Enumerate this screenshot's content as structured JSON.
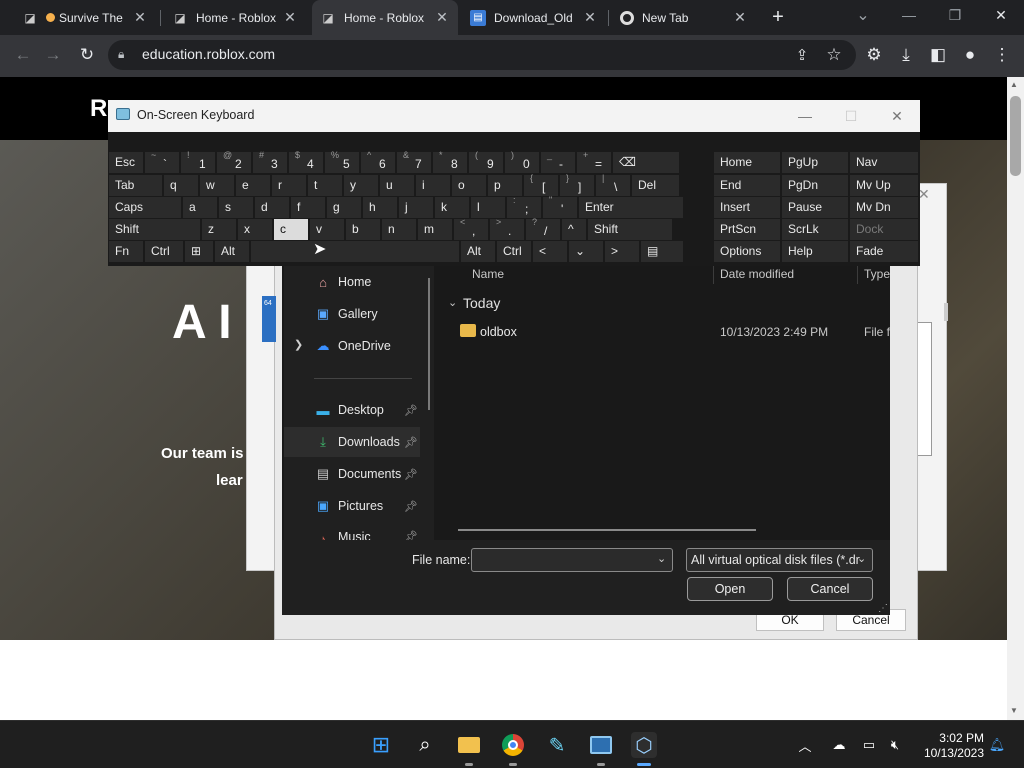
{
  "browser": {
    "tabs": [
      {
        "title": "Survive The",
        "icon": "roblox-icon"
      },
      {
        "title": "Home - Roblox",
        "icon": "roblox-icon"
      },
      {
        "title": "Home - Roblox",
        "icon": "roblox-icon"
      },
      {
        "title": "Download_Old",
        "icon": "document-icon"
      },
      {
        "title": "New Tab",
        "icon": "chrome-icon"
      }
    ],
    "new_tab": "+",
    "window_controls": {
      "minimize": "—",
      "restore": "❐",
      "close": "✕",
      "tab_search": "⌄"
    },
    "url": "education.roblox.com"
  },
  "page": {
    "logo": "R",
    "hero_title": "A I",
    "hero_line1": "Our team is",
    "hero_line2": "lear",
    "bg_dialog": {
      "close": "✕",
      "ok": "OK",
      "cancel": "Cancel",
      "badge": "64"
    }
  },
  "file_dialog": {
    "nav": [
      {
        "label": "Home",
        "icon": "home-icon"
      },
      {
        "label": "Gallery",
        "icon": "gallery-icon"
      },
      {
        "label": "OneDrive",
        "icon": "cloud-icon"
      },
      {
        "label": "Desktop",
        "icon": "desktop-icon"
      },
      {
        "label": "Downloads",
        "icon": "download-icon"
      },
      {
        "label": "Documents",
        "icon": "documents-icon"
      },
      {
        "label": "Pictures",
        "icon": "pictures-icon"
      },
      {
        "label": "Music",
        "icon": "music-icon"
      }
    ],
    "columns": {
      "name": "Name",
      "date": "Date modified",
      "type": "Type"
    },
    "group": "Today",
    "files": [
      {
        "name": "oldbox",
        "date": "10/13/2023 2:49 PM",
        "type": "File fo"
      }
    ],
    "file_name_label": "File name:",
    "file_name_value": "",
    "filter": "All virtual optical disk files (*.dr",
    "open": "Open",
    "cancel": "Cancel"
  },
  "osk": {
    "title": "On-Screen Keyboard",
    "rows": [
      [
        {
          "label": "Esc",
          "w": 36
        },
        {
          "shift": "~",
          "label": "`",
          "w": 36
        },
        {
          "shift": "!",
          "label": "1",
          "w": 36
        },
        {
          "shift": "@",
          "label": "2",
          "w": 36
        },
        {
          "shift": "#",
          "label": "3",
          "w": 36
        },
        {
          "shift": "$",
          "label": "4",
          "w": 36
        },
        {
          "shift": "%",
          "label": "5",
          "w": 36
        },
        {
          "shift": "^",
          "label": "6",
          "w": 36
        },
        {
          "shift": "&",
          "label": "7",
          "w": 36
        },
        {
          "shift": "*",
          "label": "8",
          "w": 36
        },
        {
          "shift": "(",
          "label": "9",
          "w": 36
        },
        {
          "shift": ")",
          "label": "0",
          "w": 36
        },
        {
          "shift": "_",
          "label": "-",
          "w": 36
        },
        {
          "shift": "+",
          "label": "=",
          "w": 36
        },
        {
          "label": "⌫",
          "w": 68
        }
      ],
      [
        {
          "label": "Tab",
          "w": 55
        },
        {
          "label": "q",
          "w": 36
        },
        {
          "label": "w",
          "w": 36
        },
        {
          "label": "e",
          "w": 36
        },
        {
          "label": "r",
          "w": 36
        },
        {
          "label": "t",
          "w": 36
        },
        {
          "label": "y",
          "w": 36
        },
        {
          "label": "u",
          "w": 36
        },
        {
          "label": "i",
          "w": 36
        },
        {
          "label": "o",
          "w": 36
        },
        {
          "label": "p",
          "w": 36
        },
        {
          "shift": "{",
          "label": "[",
          "w": 36
        },
        {
          "shift": "}",
          "label": "]",
          "w": 36
        },
        {
          "shift": "|",
          "label": "\\",
          "w": 36
        },
        {
          "label": "Del",
          "w": 49
        }
      ],
      [
        {
          "label": "Caps",
          "w": 74
        },
        {
          "label": "a",
          "w": 36
        },
        {
          "label": "s",
          "w": 36
        },
        {
          "label": "d",
          "w": 36
        },
        {
          "label": "f",
          "w": 36
        },
        {
          "label": "g",
          "w": 36
        },
        {
          "label": "h",
          "w": 36
        },
        {
          "label": "j",
          "w": 36
        },
        {
          "label": "k",
          "w": 36
        },
        {
          "label": "l",
          "w": 36
        },
        {
          "shift": ":",
          "label": ";",
          "w": 36
        },
        {
          "shift": "\"",
          "label": "'",
          "w": 36
        },
        {
          "label": "Enter",
          "w": 106
        }
      ],
      [
        {
          "label": "Shift",
          "w": 93
        },
        {
          "label": "z",
          "w": 36
        },
        {
          "label": "x",
          "w": 36
        },
        {
          "label": "c",
          "w": 36
        },
        {
          "label": "v",
          "w": 36
        },
        {
          "label": "b",
          "w": 36
        },
        {
          "label": "n",
          "w": 36
        },
        {
          "label": "m",
          "w": 36
        },
        {
          "shift": "<",
          "label": ",",
          "w": 36
        },
        {
          "shift": ">",
          "label": ".",
          "w": 36
        },
        {
          "shift": "?",
          "label": "/",
          "w": 36
        },
        {
          "label": "^",
          "w": 26
        },
        {
          "label": "Shift",
          "w": 86
        }
      ],
      [
        {
          "label": "Fn",
          "w": 36
        },
        {
          "label": "Ctrl",
          "w": 40
        },
        {
          "label": "⊞",
          "w": 30
        },
        {
          "label": "Alt",
          "w": 36
        },
        {
          "label": "",
          "w": 210
        },
        {
          "label": "Alt",
          "w": 36
        },
        {
          "label": "Ctrl",
          "w": 36
        },
        {
          "label": "<",
          "w": 36
        },
        {
          "label": "⌄",
          "w": 36
        },
        {
          "label": ">",
          "w": 36
        },
        {
          "label": "▤",
          "w": 44
        }
      ]
    ],
    "right_keys": [
      [
        "Home",
        "PgUp",
        "Nav"
      ],
      [
        "End",
        "PgDn",
        "Mv Up"
      ],
      [
        "Insert",
        "Pause",
        "Mv Dn"
      ],
      [
        "PrtScn",
        "ScrLk",
        "Dock"
      ],
      [
        "Options",
        "Help",
        "Fade"
      ]
    ],
    "highlighted_key": "c"
  },
  "taskbar": {
    "time": "3:02 PM",
    "date": "10/13/2023",
    "apps": [
      "windows-start-icon",
      "search-icon",
      "file-explorer-icon",
      "chrome-icon",
      "paint-icon",
      "virtualbox-manager-icon",
      "virtualbox-icon"
    ],
    "tray": [
      "chevron-up-icon",
      "onedrive-icon",
      "display-icon",
      "volume-icon",
      "notification-bell-icon"
    ]
  },
  "colors": {
    "accent": "#0a84ff",
    "folder": "#e8b84a",
    "dark_bg": "#191919"
  }
}
